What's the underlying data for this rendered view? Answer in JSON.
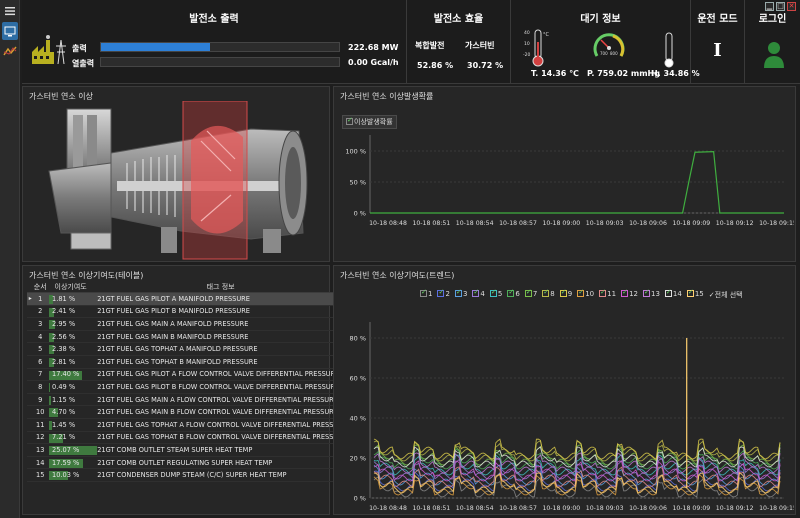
{
  "header": {
    "power": {
      "title": "발전소 출력",
      "output_label": "출력",
      "heat_label": "열출력",
      "output_value": "222.68 MW",
      "heat_value": "0.00 Gcal/h",
      "output_fraction": 0.46,
      "heat_fraction": 0.0
    },
    "efficiency": {
      "title": "발전소 효율",
      "combined_label": "복합발전",
      "gt_label": "가스터빈",
      "combined_value": "52.86 %",
      "gt_value": "30.72 %"
    },
    "atmosphere": {
      "title": "대기 정보",
      "temperature": "T.  14.36 ℃",
      "pressure": "P. 759.02 mmHg",
      "humidity": "H.  34.86 %",
      "thermo_ticks": [
        "40",
        "10",
        "-20"
      ],
      "gauge_ticks": [
        "700",
        "800"
      ]
    },
    "mode": {
      "title": "운전 모드",
      "value_symbol": "I"
    },
    "login": {
      "title": "로그인"
    }
  },
  "panels": {
    "combustion_image_title": "가스터빈 연소 이상",
    "probability_title": "가스터빈 연소 이상발생확률",
    "table_title": "가스터빈 연소 이상기여도(테이블)",
    "trend_title": "가스터빈 연소 이상기여도(트렌드)"
  },
  "table": {
    "headers": [
      "순서",
      "이상기여도",
      "태그 정보"
    ],
    "rows": [
      {
        "no": "1",
        "value": "1.81 %",
        "pct": 1.81,
        "tag": "21GT FUEL GAS PILOT A MANIFOLD PRESSURE"
      },
      {
        "no": "2",
        "value": "2.41 %",
        "pct": 2.41,
        "tag": "21GT FUEL GAS PILOT B MANIFOLD PRESSURE"
      },
      {
        "no": "3",
        "value": "2.95 %",
        "pct": 2.95,
        "tag": "21GT FUEL GAS MAIN A MANIFOLD PRESSURE"
      },
      {
        "no": "4",
        "value": "2.56 %",
        "pct": 2.56,
        "tag": "21GT FUEL GAS MAIN B MANIFOLD PRESSURE"
      },
      {
        "no": "5",
        "value": "2.38 %",
        "pct": 2.38,
        "tag": "21GT FUEL GAS TOPHAT A MANIFOLD PRESSURE"
      },
      {
        "no": "6",
        "value": "2.81 %",
        "pct": 2.81,
        "tag": "21GT FUEL GAS TOPHAT B MANIFOLD PRESSURE"
      },
      {
        "no": "7",
        "value": "17.40 %",
        "pct": 17.4,
        "tag": "21GT FUEL GAS PILOT A FLOW CONTROL VALVE DIFFERENTIAL PRESSURE"
      },
      {
        "no": "8",
        "value": "0.49 %",
        "pct": 0.49,
        "tag": "21GT FUEL GAS PILOT B FLOW CONTROL VALVE DIFFERENTIAL PRESSURE"
      },
      {
        "no": "9",
        "value": "1.15 %",
        "pct": 1.15,
        "tag": "21GT FUEL GAS MAIN A FLOW CONTROL VALVE DIFFERENTIAL PRESSURE"
      },
      {
        "no": "10",
        "value": "4.70 %",
        "pct": 4.7,
        "tag": "21GT FUEL GAS MAIN B FLOW CONTROL VALVE DIFFERENTIAL PRESSURE"
      },
      {
        "no": "11",
        "value": "1.45 %",
        "pct": 1.45,
        "tag": "21GT FUEL GAS TOPHAT A FLOW CONTROL VALVE DIFFERENTIAL PRESSURE"
      },
      {
        "no": "12",
        "value": "7.21 %",
        "pct": 7.21,
        "tag": "21GT FUEL GAS TOPHAT B FLOW CONTROL VALVE DIFFERENTIAL PRESSURE"
      },
      {
        "no": "13",
        "value": "25.07 %",
        "pct": 25.07,
        "tag": "21GT COMB OUTLET STEAM SUPER HEAT TEMP"
      },
      {
        "no": "14",
        "value": "17.59 %",
        "pct": 17.59,
        "tag": "21GT COMB OUTLET REGULATING SUPER HEAT TEMP"
      },
      {
        "no": "15",
        "value": "10.03 %",
        "pct": 10.03,
        "tag": "21GT CONDENSER DUMP STEAM (C/C) SUPER HEAT TEMP"
      }
    ]
  },
  "chart_data": [
    {
      "type": "line",
      "legend": [
        "이상발생확률"
      ],
      "x": [
        "10-18 08:48",
        "10-18 08:51",
        "10-18 08:54",
        "10-18 08:57",
        "10-18 09:00",
        "10-18 09:03",
        "10-18 09:06",
        "10-18 09:09",
        "10-18 09:12",
        "10-18 09:15"
      ],
      "y_ticks": [
        "100 %",
        "50 %",
        "0 %"
      ],
      "ylim": [
        0,
        100
      ],
      "series": [
        {
          "color": "#3fae3f",
          "points": [
            [
              0,
              0
            ],
            [
              0.755,
              0
            ],
            [
              0.77,
              50
            ],
            [
              0.785,
              98
            ],
            [
              0.83,
              99
            ],
            [
              0.845,
              0
            ],
            [
              1,
              0
            ]
          ]
        }
      ]
    },
    {
      "type": "line",
      "x": [
        "10-18 08:48",
        "10-18 08:51",
        "10-18 08:54",
        "10-18 08:57",
        "10-18 09:00",
        "10-18 09:03",
        "10-18 09:06",
        "10-18 09:09",
        "10-18 09:12",
        "10-18 09:15"
      ],
      "y_ticks": [
        "80 %",
        "60 %",
        "40 %",
        "20 %",
        "0 %"
      ],
      "ylim": [
        0,
        80
      ],
      "legend": [
        "1",
        "2",
        "3",
        "4",
        "5",
        "6",
        "7",
        "8",
        "9",
        "10",
        "11",
        "12",
        "13",
        "14",
        "15"
      ],
      "legend_all": "전체 선택",
      "series_colors": [
        "#8a8a8a",
        "#5a6fe0",
        "#5aa0e0",
        "#9a7ad8",
        "#3fbfbf",
        "#4fae5a",
        "#7abf4a",
        "#b9b94a",
        "#d8c94a",
        "#e0a040",
        "#e08a8a",
        "#d05ad0",
        "#c07ad8",
        "#e0e0e0",
        "#ffd070"
      ],
      "spike": {
        "series": "15",
        "x": "10-18 09:10",
        "y": 80
      }
    }
  ]
}
